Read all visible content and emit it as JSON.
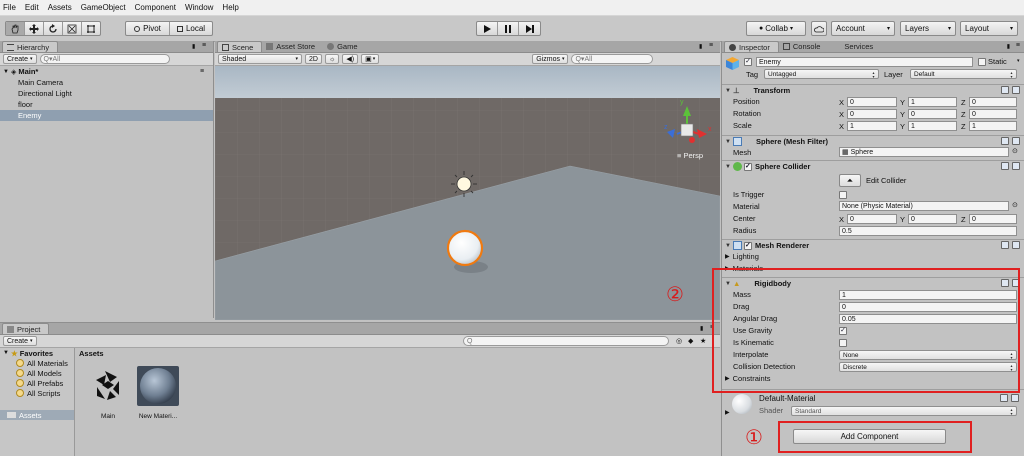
{
  "menu": [
    "File",
    "Edit",
    "Assets",
    "GameObject",
    "Component",
    "Window",
    "Help"
  ],
  "toolbar": {
    "pivot": "Pivot",
    "local": "Local",
    "collab": "Collab",
    "account": "Account",
    "layers": "Layers",
    "layout": "Layout"
  },
  "hierarchy": {
    "tab": "Hierarchy",
    "create": "Create",
    "search_placeholder": "Q▾All",
    "scene_name": "Main*",
    "items": [
      "Main Camera",
      "Directional Light",
      "floor",
      "Enemy"
    ],
    "selected_index": 3
  },
  "scene": {
    "tabs": [
      "Scene",
      "Asset Store",
      "Game"
    ],
    "shading": "Shaded",
    "mode_2d": "2D",
    "gizmos": "Gizmos",
    "search_placeholder": "Q▾All",
    "persp": "Persp",
    "gizmo_axes": [
      "y",
      "x",
      "z"
    ]
  },
  "project": {
    "tab": "Project",
    "create": "Create",
    "favorites_title": "Favorites",
    "favorites": [
      "All Materials",
      "All Models",
      "All Prefabs",
      "All Scripts"
    ],
    "assets_root": "Assets",
    "assets_header": "Assets",
    "assets": [
      {
        "label": "Main",
        "icon": "unity-scene-icon"
      },
      {
        "label": "New Materi...",
        "icon": "material-sphere-icon"
      }
    ]
  },
  "inspector": {
    "tabs": [
      "Inspector",
      "Console",
      "Services"
    ],
    "object_name": "Enemy",
    "static_label": "Static",
    "tag_label": "Tag",
    "tag_value": "Untagged",
    "layer_label": "Layer",
    "layer_value": "Default",
    "transform": {
      "title": "Transform",
      "rows": [
        {
          "label": "Position",
          "x": "0",
          "y": "1",
          "z": "0"
        },
        {
          "label": "Rotation",
          "x": "0",
          "y": "0",
          "z": "0"
        },
        {
          "label": "Scale",
          "x": "1",
          "y": "1",
          "z": "1"
        }
      ]
    },
    "mesh_filter": {
      "title": "Sphere (Mesh Filter)",
      "mesh_label": "Mesh",
      "mesh_value": "Sphere"
    },
    "sphere_collider": {
      "title": "Sphere Collider",
      "edit_collider": "Edit Collider",
      "is_trigger_label": "Is Trigger",
      "is_trigger": false,
      "material_label": "Material",
      "material_value": "None (Physic Material)",
      "center_label": "Center",
      "center": {
        "x": "0",
        "y": "0",
        "z": "0"
      },
      "radius_label": "Radius",
      "radius_value": "0.5"
    },
    "mesh_renderer": {
      "title": "Mesh Renderer",
      "lighting": "Lighting",
      "materials": "Materials"
    },
    "rigidbody": {
      "title": "Rigidbody",
      "mass_label": "Mass",
      "mass": "1",
      "drag_label": "Drag",
      "drag": "0",
      "angular_drag_label": "Angular Drag",
      "angular_drag": "0.05",
      "use_gravity_label": "Use Gravity",
      "use_gravity": true,
      "is_kinematic_label": "Is Kinematic",
      "is_kinematic": false,
      "interpolate_label": "Interpolate",
      "interpolate": "None",
      "collision_label": "Collision Detection",
      "collision": "Discrete",
      "constraints_label": "Constraints"
    },
    "material": {
      "name": "Default-Material",
      "shader_label": "Shader",
      "shader_value": "Standard"
    },
    "add_component": "Add Component"
  },
  "annotations": {
    "one": "①",
    "two": "②"
  },
  "colors": {
    "red_annotation": "#e02020",
    "selection": "#8f9fb0",
    "sky": "#b9c8d6",
    "ground": "#6f6966",
    "floor": "#8c949a"
  }
}
